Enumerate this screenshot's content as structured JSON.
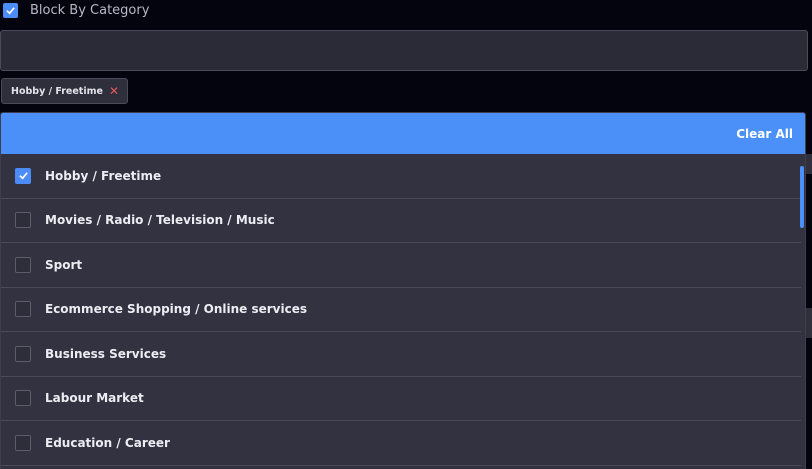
{
  "header": {
    "label": "Block By Category",
    "checked": true
  },
  "search": {
    "value": "",
    "placeholder": ""
  },
  "chips": [
    {
      "label": "Hobby / Freetime",
      "remove_glyph": "✕"
    }
  ],
  "dropdown": {
    "clear_all_label": "Clear All",
    "options": [
      {
        "label": "Hobby / Freetime",
        "checked": true
      },
      {
        "label": "Movies / Radio / Television / Music",
        "checked": false
      },
      {
        "label": "Sport",
        "checked": false
      },
      {
        "label": "Ecommerce Shopping / Online services",
        "checked": false
      },
      {
        "label": "Business Services",
        "checked": false
      },
      {
        "label": "Labour Market",
        "checked": false
      },
      {
        "label": "Education / Career",
        "checked": false
      }
    ]
  },
  "colors": {
    "accent": "#4a90f8",
    "remove": "#e05a5a",
    "panel": "#333241"
  },
  "icons": {
    "check": "check-icon",
    "remove": "close-icon"
  }
}
